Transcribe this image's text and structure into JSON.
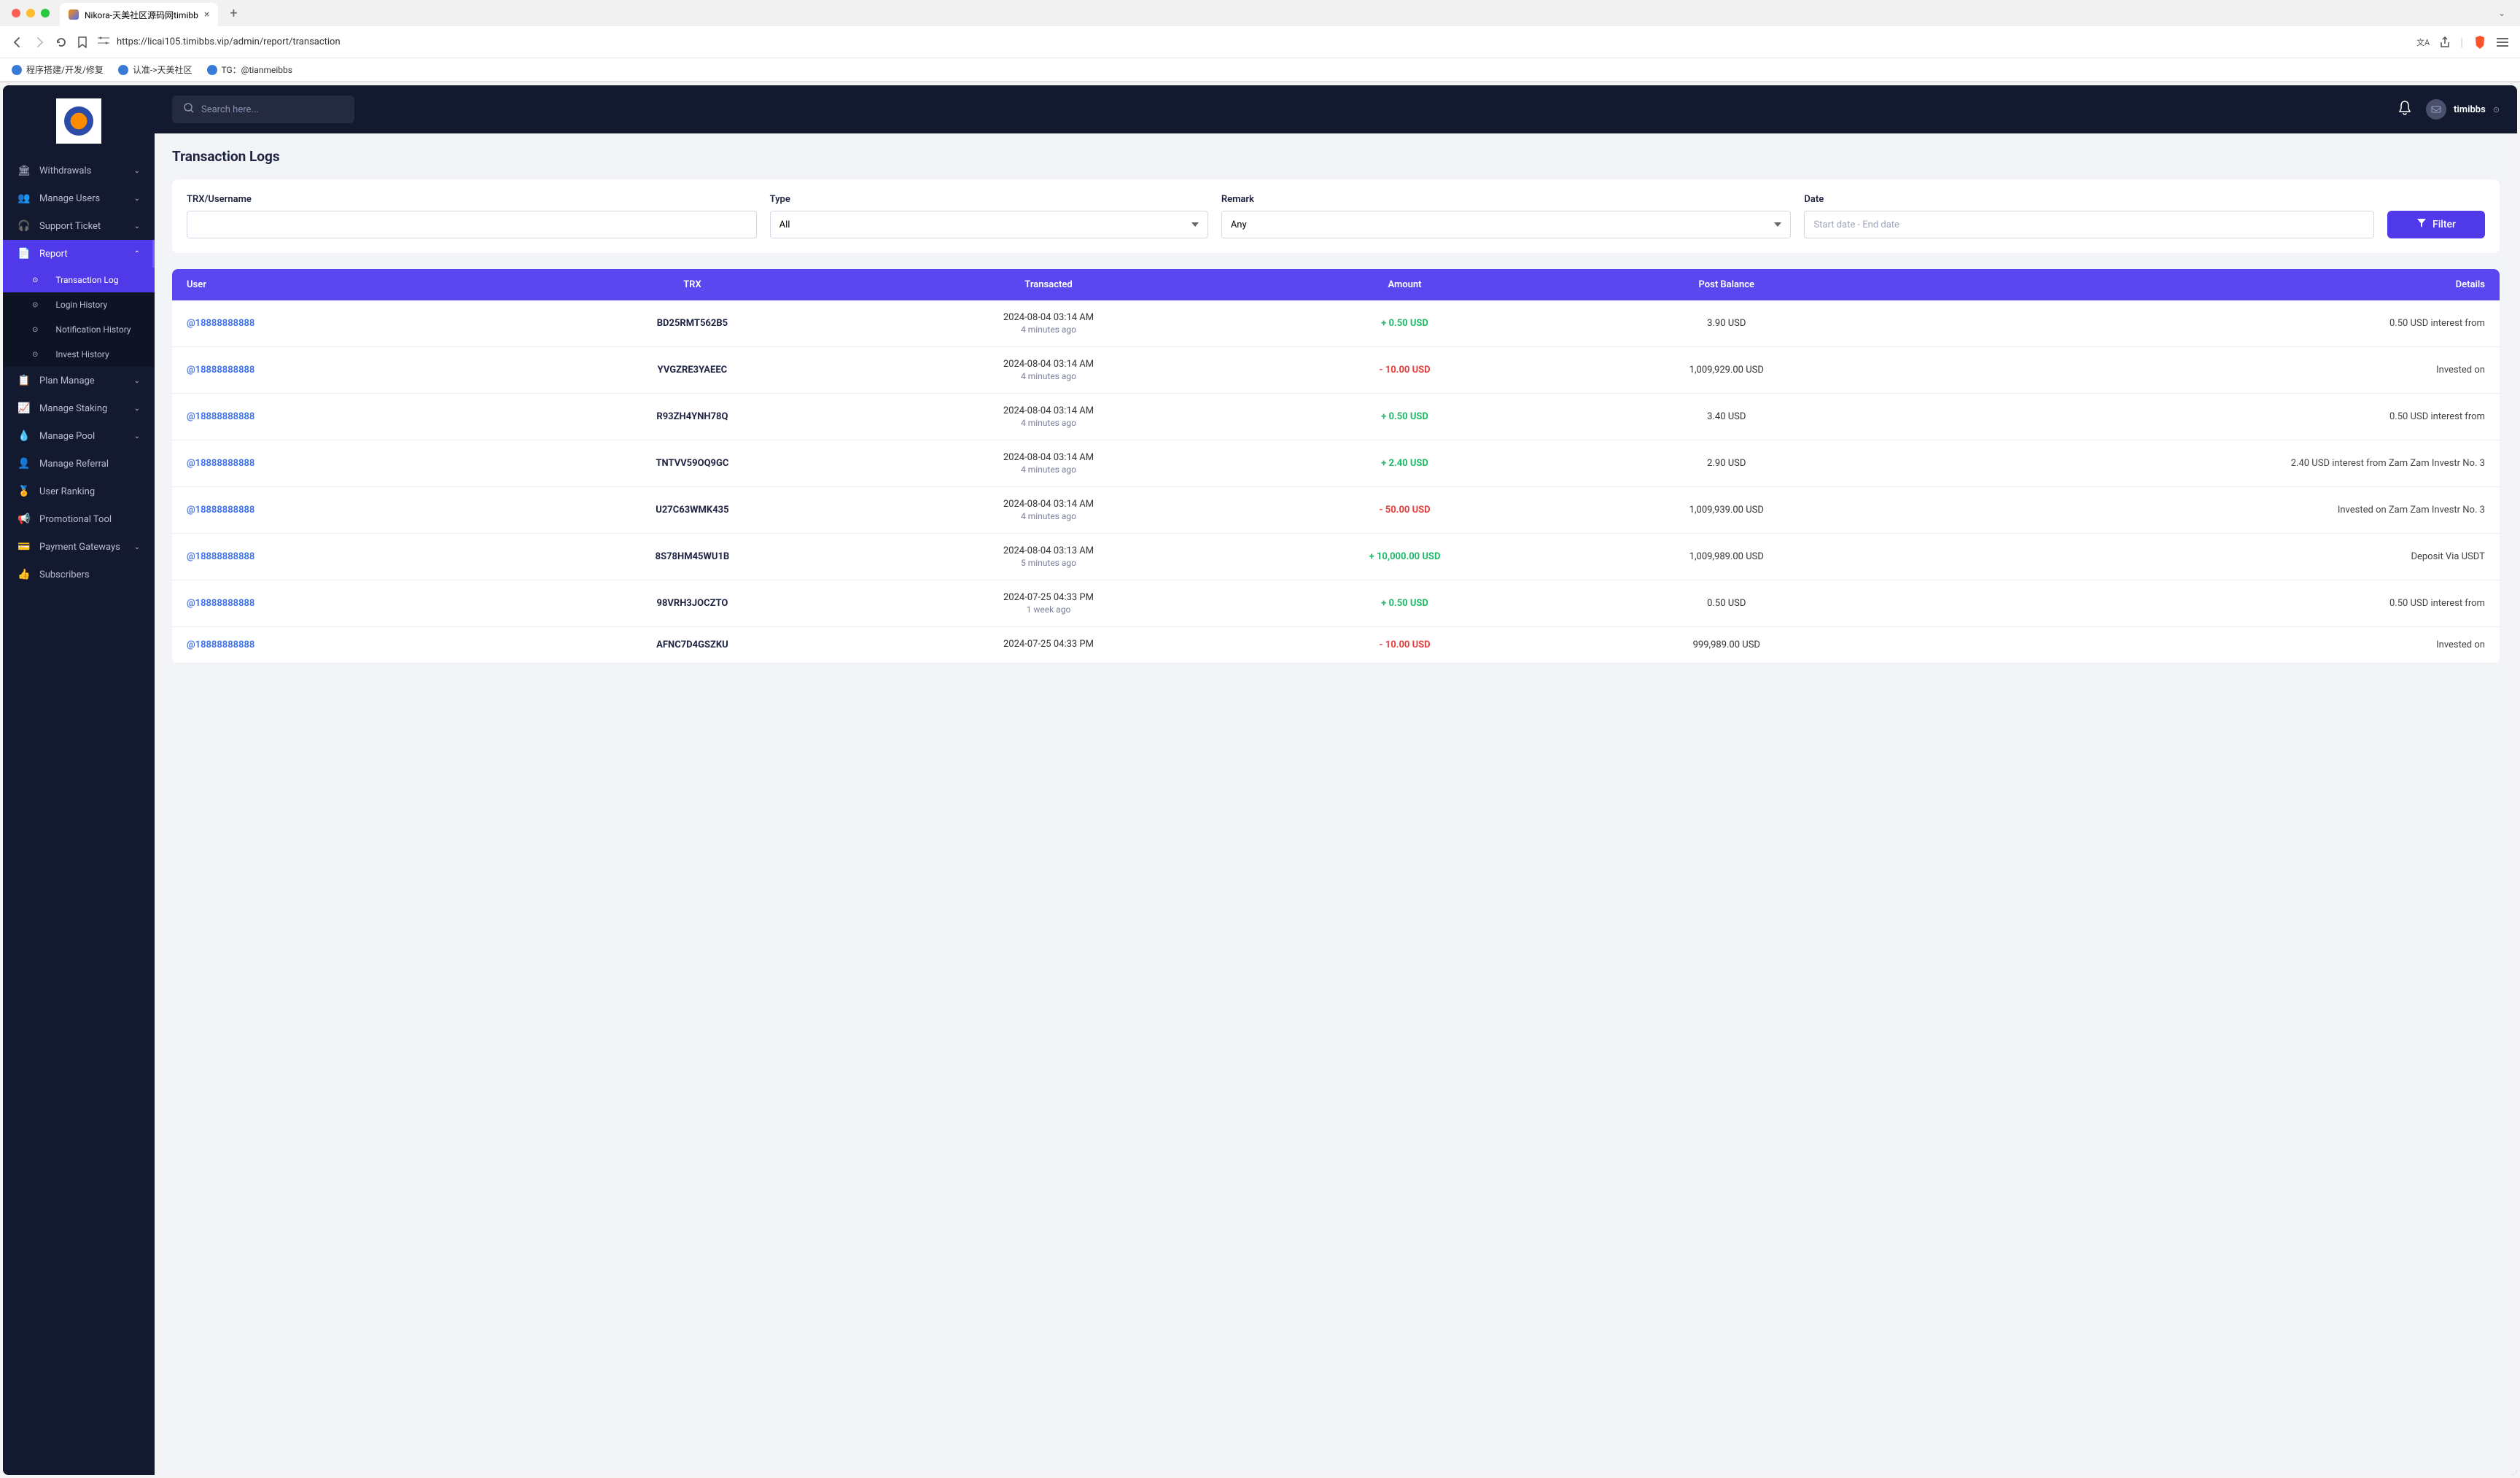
{
  "browser": {
    "tab_title": "Nikora-天美社区源码网timibb",
    "url": "https://licai105.timibbs.vip/admin/report/transaction",
    "bookmarks": [
      {
        "label": "程序搭建/开发/修复"
      },
      {
        "label": "认准->天美社区"
      },
      {
        "label": "TG：@tianmeibbs"
      }
    ]
  },
  "topbar": {
    "search_placeholder": "Search here...",
    "username": "timibbs"
  },
  "sidebar": {
    "items": [
      {
        "icon": "🏛",
        "label": "Withdrawals",
        "expandable": true
      },
      {
        "icon": "👥",
        "label": "Manage Users",
        "expandable": true
      },
      {
        "icon": "🎧",
        "label": "Support Ticket",
        "expandable": true
      },
      {
        "icon": "📄",
        "label": "Report",
        "expandable": true,
        "active": true,
        "expanded": true
      },
      {
        "icon": "📋",
        "label": "Plan Manage",
        "expandable": true
      },
      {
        "icon": "📈",
        "label": "Manage Staking",
        "expandable": true
      },
      {
        "icon": "💧",
        "label": "Manage Pool",
        "expandable": true
      },
      {
        "icon": "👤",
        "label": "Manage Referral",
        "expandable": false
      },
      {
        "icon": "🏅",
        "label": "User Ranking",
        "expandable": false
      },
      {
        "icon": "📢",
        "label": "Promotional Tool",
        "expandable": false
      },
      {
        "icon": "💳",
        "label": "Payment Gateways",
        "expandable": true
      },
      {
        "icon": "👍",
        "label": "Subscribers",
        "expandable": false
      }
    ],
    "report_subitems": [
      {
        "label": "Transaction Log",
        "active": true
      },
      {
        "label": "Login History"
      },
      {
        "label": "Notification History"
      },
      {
        "label": "Invest History"
      }
    ]
  },
  "page": {
    "title": "Transaction Logs"
  },
  "filters": {
    "trx_label": "TRX/Username",
    "type_label": "Type",
    "type_value": "All",
    "remark_label": "Remark",
    "remark_value": "Any",
    "date_label": "Date",
    "date_placeholder": "Start date - End date",
    "button_label": "Filter"
  },
  "table": {
    "headers": {
      "user": "User",
      "trx": "TRX",
      "transacted": "Transacted",
      "amount": "Amount",
      "balance": "Post Balance",
      "details": "Details"
    },
    "rows": [
      {
        "user": "@18888888888",
        "trx": "BD25RMT562B5",
        "date": "2024-08-04 03:14 AM",
        "ago": "4 minutes ago",
        "amount": "+ 0.50 USD",
        "amt_class": "pos",
        "balance": "3.90 USD",
        "details": "0.50 USD interest from"
      },
      {
        "user": "@18888888888",
        "trx": "YVGZRE3YAEEC",
        "date": "2024-08-04 03:14 AM",
        "ago": "4 minutes ago",
        "amount": "- 10.00 USD",
        "amt_class": "neg",
        "balance": "1,009,929.00 USD",
        "details": "Invested on"
      },
      {
        "user": "@18888888888",
        "trx": "R93ZH4YNH78Q",
        "date": "2024-08-04 03:14 AM",
        "ago": "4 minutes ago",
        "amount": "+ 0.50 USD",
        "amt_class": "pos",
        "balance": "3.40 USD",
        "details": "0.50 USD interest from"
      },
      {
        "user": "@18888888888",
        "trx": "TNTVV59OQ9GC",
        "date": "2024-08-04 03:14 AM",
        "ago": "4 minutes ago",
        "amount": "+ 2.40 USD",
        "amt_class": "pos",
        "balance": "2.90 USD",
        "details": "2.40 USD interest from Zam Zam Investr No. 3"
      },
      {
        "user": "@18888888888",
        "trx": "U27C63WMK435",
        "date": "2024-08-04 03:14 AM",
        "ago": "4 minutes ago",
        "amount": "- 50.00 USD",
        "amt_class": "neg",
        "balance": "1,009,939.00 USD",
        "details": "Invested on Zam Zam Investr No. 3"
      },
      {
        "user": "@18888888888",
        "trx": "8S78HM45WU1B",
        "date": "2024-08-04 03:13 AM",
        "ago": "5 minutes ago",
        "amount": "+ 10,000.00 USD",
        "amt_class": "pos",
        "balance": "1,009,989.00 USD",
        "details": "Deposit Via USDT"
      },
      {
        "user": "@18888888888",
        "trx": "98VRH3JOCZTO",
        "date": "2024-07-25 04:33 PM",
        "ago": "1 week ago",
        "amount": "+ 0.50 USD",
        "amt_class": "pos",
        "balance": "0.50 USD",
        "details": "0.50 USD interest from"
      },
      {
        "user": "@18888888888",
        "trx": "AFNC7D4GSZKU",
        "date": "2024-07-25 04:33 PM",
        "ago": "",
        "amount": "- 10.00 USD",
        "amt_class": "neg",
        "balance": "999,989.00 USD",
        "details": "Invested on"
      }
    ]
  }
}
